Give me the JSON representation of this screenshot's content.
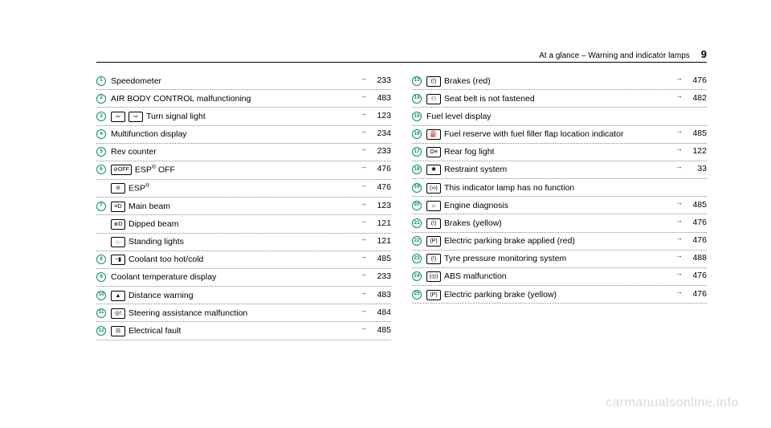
{
  "header": {
    "title": "At a glance – Warning and indicator lamps",
    "page": "9"
  },
  "left": [
    {
      "badge": "1",
      "icons": [],
      "label": "Speedometer",
      "page": "233"
    },
    {
      "badge": "2",
      "icons": [],
      "label": "AIR BODY CONTROL malfunctioning",
      "page": "483"
    },
    {
      "badge": "3",
      "icons": [
        "⇦",
        "⇨"
      ],
      "label": "Turn signal light",
      "page": "123"
    },
    {
      "badge": "4",
      "icons": [],
      "label": "Multifunction display",
      "page": "234"
    },
    {
      "badge": "5",
      "icons": [],
      "label": "Rev counter",
      "page": "233"
    },
    {
      "badge": "6",
      "icons": [
        "⊘OFF"
      ],
      "label": "ESP® OFF",
      "page": "476"
    },
    {
      "badge": "",
      "icons": [
        "⊘"
      ],
      "label": "ESP®",
      "page": "476"
    },
    {
      "badge": "7",
      "icons": [
        "≡D"
      ],
      "label": "Main beam",
      "page": "123"
    },
    {
      "badge": "",
      "icons": [
        "≣D"
      ],
      "label": "Dipped beam",
      "page": "121"
    },
    {
      "badge": "",
      "icons": [
        "჻჻"
      ],
      "label": "Standing lights",
      "page": "121"
    },
    {
      "badge": "8",
      "icons": [
        "~▮"
      ],
      "label": "Coolant too hot/cold",
      "page": "485"
    },
    {
      "badge": "9",
      "icons": [],
      "label": "Coolant temperature display",
      "page": "233"
    },
    {
      "badge": "10",
      "icons": [
        "▲"
      ],
      "label": "Distance warning",
      "page": "483"
    },
    {
      "badge": "11",
      "icons": [
        "◎!"
      ],
      "label": "Steering assistance malfunction",
      "page": "484"
    },
    {
      "badge": "12",
      "icons": [
        "⊟"
      ],
      "label": "Electrical fault",
      "page": "485"
    }
  ],
  "right": [
    {
      "badge": "13",
      "icons": [
        "(!)"
      ],
      "label": "Brakes (red)",
      "page": "476"
    },
    {
      "badge": "14",
      "icons": [
        "⚇"
      ],
      "label": "Seat belt is not fastened",
      "page": "482"
    },
    {
      "badge": "15",
      "icons": [],
      "label": "Fuel level display",
      "page": ""
    },
    {
      "badge": "16",
      "icons": [
        "⛽"
      ],
      "label": "Fuel reserve with fuel filler flap location indicator",
      "page": "485"
    },
    {
      "badge": "17",
      "icons": [
        "O≡"
      ],
      "label": "Rear fog light",
      "page": "122"
    },
    {
      "badge": "18",
      "icons": [
        "✱"
      ],
      "label": "Restraint system",
      "page": "33"
    },
    {
      "badge": "19",
      "icons": [
        "(∞)"
      ],
      "label": "This indicator lamp has no function",
      "page": ""
    },
    {
      "badge": "20",
      "icons": [
        "⌂"
      ],
      "label": "Engine diagnosis",
      "page": "485"
    },
    {
      "badge": "21",
      "icons": [
        "(!)"
      ],
      "label": "Brakes (yellow)",
      "page": "476"
    },
    {
      "badge": "22",
      "icons": [
        "(P)"
      ],
      "label": "Electric parking brake applied (red)",
      "page": "476"
    },
    {
      "badge": "23",
      "icons": [
        "(!)"
      ],
      "label": "Tyre pressure monitoring system",
      "page": "488"
    },
    {
      "badge": "24",
      "icons": [
        "(◎)"
      ],
      "label": "ABS malfunction",
      "page": "476"
    },
    {
      "badge": "25",
      "icons": [
        "(P)"
      ],
      "label": "Electric parking brake (yellow)",
      "page": "476"
    }
  ],
  "watermark": "carmanualsonline.info"
}
